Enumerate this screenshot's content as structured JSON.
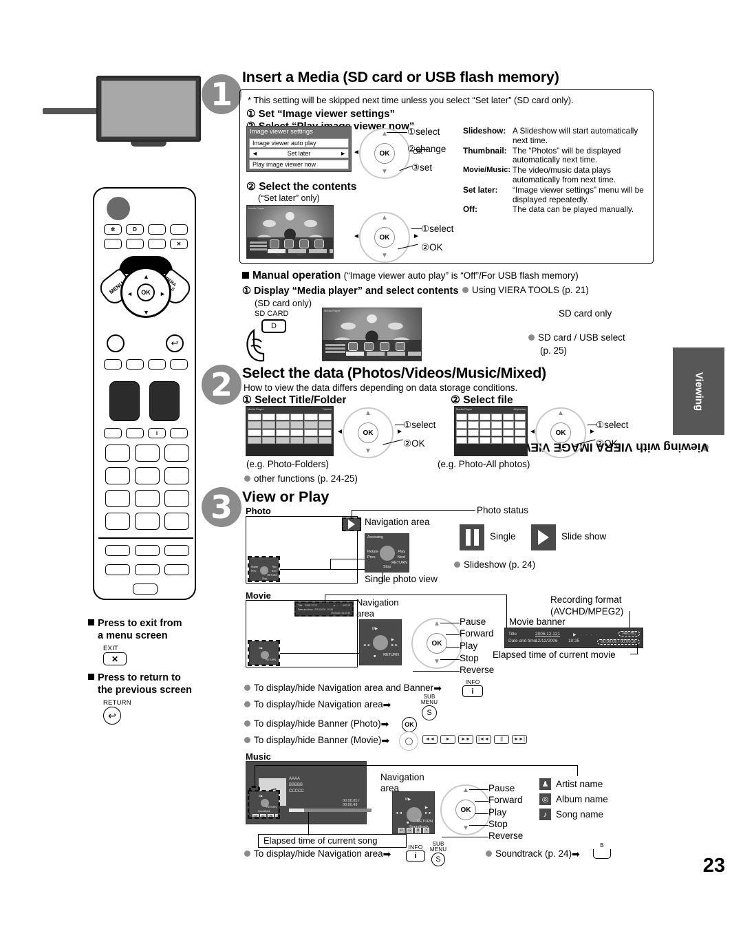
{
  "page_number": "23",
  "sidebar": {
    "tab_label": "Viewing",
    "vertical_label": "Viewing with VIERA IMAGE VIEWER"
  },
  "remote_notes": {
    "exit": {
      "heading_line1": "Press to exit from",
      "heading_line2": "a menu screen",
      "key_label": "EXIT",
      "key_glyph": "✕"
    },
    "return": {
      "heading_line1": "Press to return to",
      "heading_line2": "the previous screen",
      "key_label": "RETURN",
      "key_glyph": "↩"
    }
  },
  "remote": {
    "ok_label": "OK",
    "menu_label": "MENU",
    "viera_tools_label": "VIERA TOOLS",
    "info_label": "i",
    "exit_label": "✕",
    "sd_label": "D",
    "light_label": "✲",
    "return_label": "↩"
  },
  "step1": {
    "number": "1",
    "title": "Insert a Media (SD card or USB flash memory)",
    "note": "* This setting will be skipped next time unless you select “Set later” (SD card only).",
    "item1": "① Set “Image viewer settings”",
    "item2": "② Select “Play image viewer now”",
    "menu": {
      "title": "Image viewer settings",
      "row1": "Image viewer auto play",
      "row2": "Set later",
      "row3": "Play image viewer now",
      "arrow_left": "◄",
      "arrow_right": "►"
    },
    "dpad_captions": [
      "①select",
      "②change",
      "③set"
    ],
    "descriptions": [
      {
        "key": "Slideshow:",
        "value": "A Slideshow will start automatically next time."
      },
      {
        "key": "Thumbnail:",
        "value": "The “Photos” will be displayed automatically next time."
      },
      {
        "key": "Movie/Music:",
        "value": "The video/music data plays automatically from next time."
      },
      {
        "key": "Set later:",
        "value": "“Image viewer settings” menu will be displayed repeatedly."
      },
      {
        "key": "Off:",
        "value": "The data can be played manually."
      }
    ],
    "step2_heading": "② Select the contents",
    "step2_sub": "(“Set later” only)",
    "step2_dpad_captions": [
      "①select",
      "②OK"
    ],
    "media_player_label": "Media Player"
  },
  "manual": {
    "heading_bold": "Manual operation",
    "heading_rest": "(“Image viewer auto play” is “Off”/For USB flash memory)",
    "item1": "① Display “Media player” and select contents",
    "item1_sub": "(SD card only)",
    "sd_card_label": "SD CARD",
    "sd_key_glyph": "D",
    "bullet_viera_tools": "Using VIERA TOOLS (p. 21)",
    "sd_only_label": "SD card only",
    "bullet_sd_usb": "SD card / USB select",
    "bullet_sd_usb_page": "(p. 25)"
  },
  "step2": {
    "number": "2",
    "title": "Select the data (Photos/Videos/Music/Mixed)",
    "subtitle": "How to view the data differs depending on data storage conditions.",
    "col1_heading": "① Select Title/Folder",
    "col2_heading": "② Select file",
    "col1_caption": "(e.g. Photo-Folders)",
    "col2_caption": "(e.g. Photo-All photos)",
    "dpad_captions": [
      "①select",
      "②OK"
    ],
    "other_functions": "other functions (p. 24-25)",
    "screen_title": "Media Player",
    "screen_mode": "Photo",
    "screen_right1": "Folders",
    "screen_right2": "All photos"
  },
  "step3": {
    "number": "3",
    "title": "View or Play",
    "photo": {
      "label": "Photo",
      "nav_area": "Navigation area",
      "single_photo_view": "Single photo view",
      "photo_status": "Photo status",
      "single_label": "Single",
      "slideshow_label": "Slide show",
      "bullet_slideshow": "Slideshow (p. 24)",
      "accessing": "Accessing",
      "ctrl_rotate": "Rotate",
      "ctrl_prev": "Prev.",
      "ctrl_play": "Play",
      "ctrl_next": "Next",
      "ctrl_return": "RETURN",
      "ctrl_stop": "Stop"
    },
    "movie": {
      "label": "Movie",
      "nav_area_l1": "Navigation",
      "nav_area_l2": "area",
      "dpad_captions": [
        "Pause",
        "Forward",
        "Play",
        "Stop",
        "Reverse"
      ],
      "banner_label": "Movie banner",
      "recording_format_l1": "Recording format",
      "recording_format_l2": "(AVCHD/MPEG2)",
      "elapsed_label": "Elapsed time of current movie",
      "banner": {
        "title_key": "Title",
        "title_value": "2006.12.121",
        "date_key": "Date and time",
        "date_value": "12/12/2006",
        "time_value": "10:35",
        "format_badge": "AVCHD",
        "elapsed_value": "00:00.06 / 00:00.30"
      },
      "nav_return": "RETURN"
    },
    "bullets": [
      {
        "text": "To display/hide Navigation area and Banner",
        "key_label": "INFO",
        "key_glyph": "i"
      },
      {
        "text": "To display/hide Navigation area",
        "key_label_l1": "SUB",
        "key_label_l2": "MENU",
        "key_glyph": "S"
      },
      {
        "text": "To display/hide Banner (Photo)",
        "key_glyph": "OK"
      },
      {
        "text": "To display/hide Banner (Movie)",
        "keys": [
          "◄◄",
          "►",
          "►►",
          "|◄◄",
          "||",
          "►►|"
        ]
      }
    ],
    "music": {
      "label": "Music",
      "nav_area_l1": "Navigation",
      "nav_area_l2": "area",
      "dpad_captions": [
        "Pause",
        "Forward",
        "Play",
        "Stop",
        "Reverse"
      ],
      "meta": [
        {
          "icon": "person-icon",
          "glyph": "♟",
          "label": "Artist name"
        },
        {
          "icon": "disc-icon",
          "glyph": "◎",
          "label": "Album name"
        },
        {
          "icon": "note-icon",
          "glyph": "♪",
          "label": "Song name"
        }
      ],
      "elapsed_label": "Elapsed time of current song",
      "bullet_nav": "To display/hide Navigation area",
      "bullet_nav_keys": {
        "info_label": "INFO",
        "info_glyph": "i",
        "sub_l1": "SUB",
        "sub_l2": "MENU",
        "sub_glyph": "S"
      },
      "bullet_soundtrack": "Soundtrack (p. 24)",
      "bullet_soundtrack_key_label": "B",
      "soundtrack_label": "Soundtrack",
      "rows": [
        "AAAA",
        "BBBBB",
        "CCCCC"
      ],
      "time": "00:00.05 / 00:00.49",
      "nav_return": "RETURN"
    }
  },
  "colors": {
    "step_circle": "#8c8c8c",
    "sidebar_tab": "#575757",
    "bullet": "#8b8b8b",
    "screen_dark": "#4a4a4a"
  }
}
